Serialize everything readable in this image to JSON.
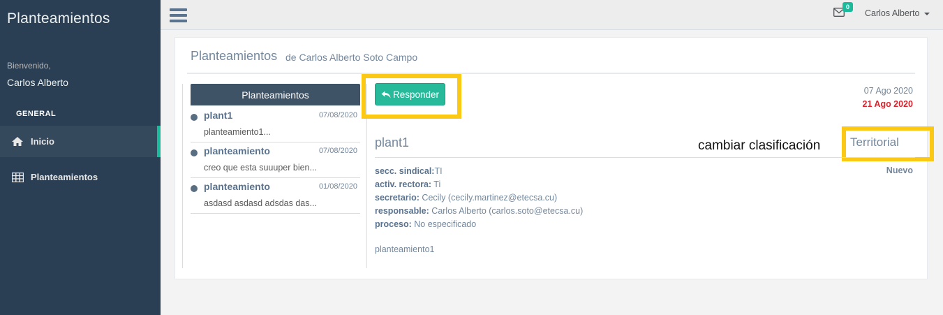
{
  "app": {
    "brand": "Planteamientos"
  },
  "sidebar": {
    "welcome": "Bienvenido,",
    "user_name": "Carlos Alberto",
    "section_title": "GENERAL",
    "items": [
      {
        "label": "Inicio",
        "icon": "home-icon",
        "active": true
      },
      {
        "label": "Planteamientos",
        "icon": "table-icon",
        "active": false
      }
    ]
  },
  "topbar": {
    "mail_icon": "envelope-icon",
    "mail_count": "0",
    "user_label": "Carlos Alberto"
  },
  "panel": {
    "title": "Planteamientos",
    "subtitle": "de Carlos Alberto Soto Campo"
  },
  "list": {
    "header": "Planteamientos",
    "messages": [
      {
        "subject": "plant1",
        "date": "07/08/2020",
        "excerpt": "planteamiento1..."
      },
      {
        "subject": "planteamiento",
        "date": "07/08/2020",
        "excerpt": "creo que esta suuuper bien..."
      },
      {
        "subject": "planteamiento",
        "date": "01/08/2020",
        "excerpt": "asdasd asdasd adsdas das..."
      }
    ]
  },
  "detail": {
    "reply_label": "Responder",
    "date_primary": "07 Ago 2020",
    "date_secondary": "21 Ago 2020",
    "title": "plant1",
    "annotation": "cambiar clasificación",
    "category": "Territorial",
    "status": "Nuevo",
    "fields": [
      {
        "label": "secc. sindical:",
        "value": "TI"
      },
      {
        "label": "activ. rectora:",
        "value": " Ti"
      },
      {
        "label": "secretario:",
        "value": " Cecily (cecily.martinez@etecsa.cu)"
      },
      {
        "label": "responsable:",
        "value": " Carlos Alberto (carlos.soto@etecsa.cu)"
      },
      {
        "label": "proceso:",
        "value": " No especificado"
      }
    ],
    "body": "planteamiento1"
  },
  "colors": {
    "sidebar": "#2a3f54",
    "accent": "#1abb9c",
    "button": "#26b99a",
    "highlight": "#fbc813",
    "due_date": "#d9232d"
  }
}
